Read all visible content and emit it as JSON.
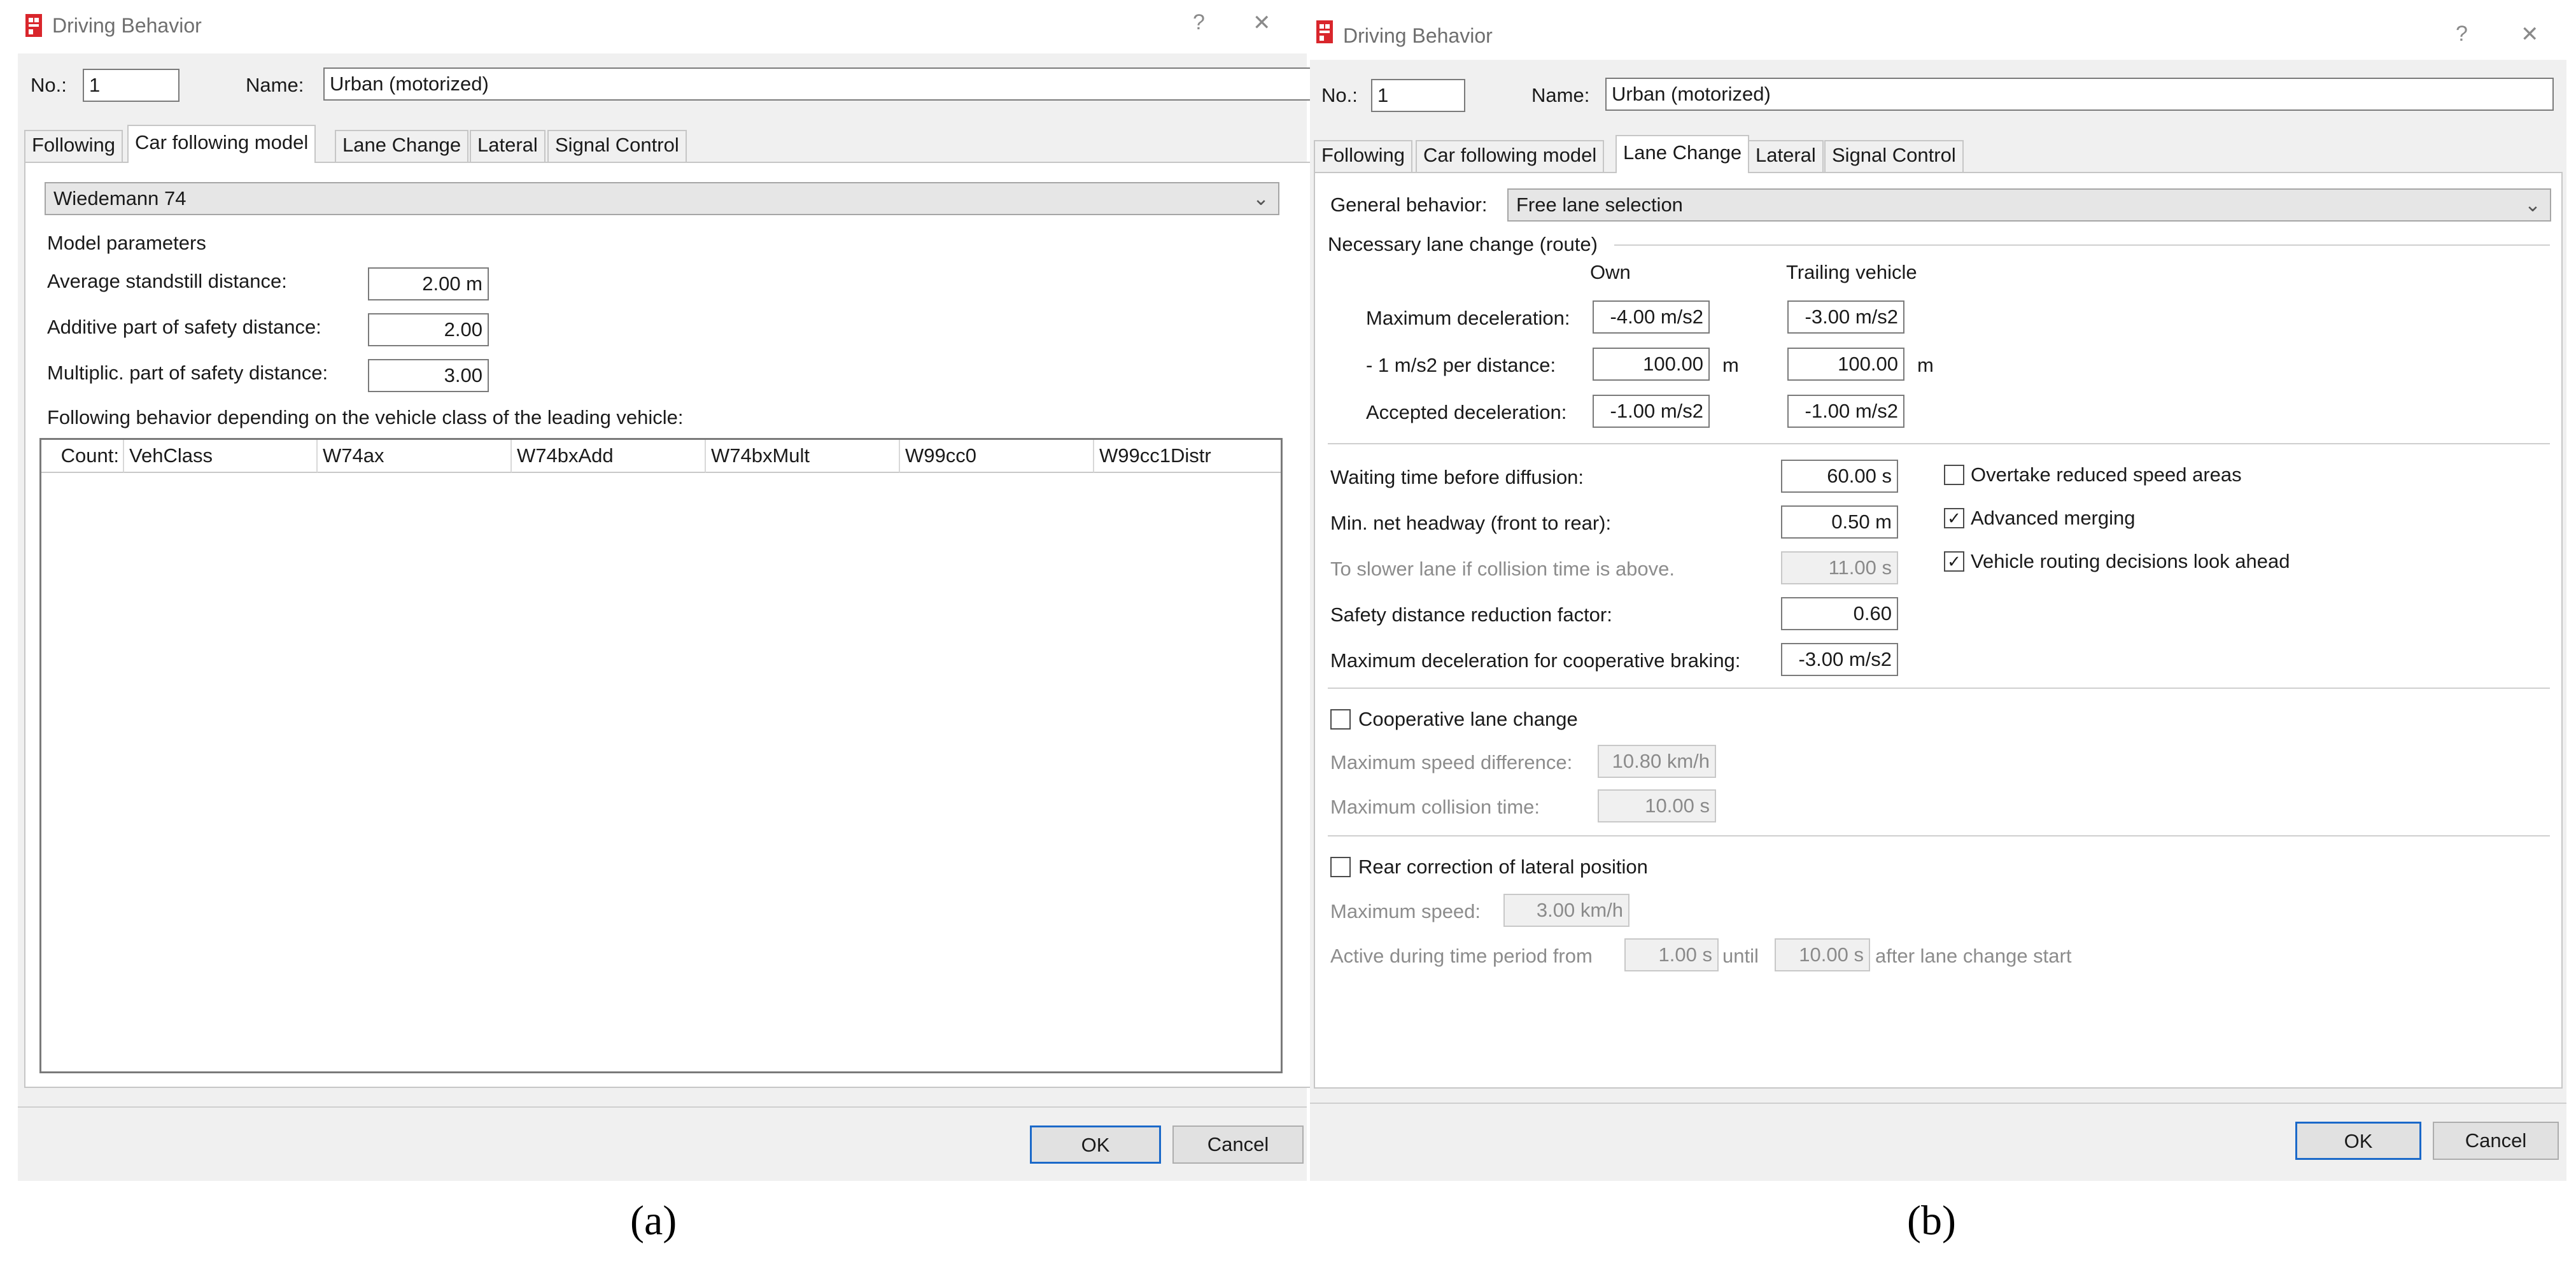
{
  "dialogA": {
    "title": "Driving Behavior",
    "help": "?",
    "close": "✕",
    "no_label": "No.:",
    "no_value": "1",
    "name_label": "Name:",
    "name_value": "Urban (motorized)",
    "tabs": [
      "Following",
      "Car following model",
      "Lane Change",
      "Lateral",
      "Signal Control"
    ],
    "model_select": "Wiedemann 74",
    "model_params_label": "Model parameters",
    "avg_standstill_label": "Average standstill distance:",
    "avg_standstill_value": "2.00 m",
    "additive_label": "Additive part of safety distance:",
    "additive_value": "2.00",
    "multiplic_label": "Multiplic. part of safety distance:",
    "multiplic_value": "3.00",
    "following_by_class_label": "Following behavior depending on the vehicle class of the leading vehicle:",
    "table_columns": [
      "Count:",
      "VehClass",
      "W74ax",
      "W74bxAdd",
      "W74bxMult",
      "W99cc0",
      "W99cc1Distr"
    ],
    "ok": "OK",
    "cancel": "Cancel",
    "caption": "(a)"
  },
  "dialogB": {
    "title": "Driving Behavior",
    "help": "?",
    "close": "✕",
    "no_label": "No.:",
    "no_value": "1",
    "name_label": "Name:",
    "name_value": "Urban (motorized)",
    "tabs": [
      "Following",
      "Car following model",
      "Lane Change",
      "Lateral",
      "Signal Control"
    ],
    "general_behavior_label": "General behavior:",
    "general_behavior_value": "Free lane selection",
    "necessary_label": "Necessary lane change (route)",
    "own_header": "Own",
    "trailing_header": "Trailing vehicle",
    "max_decel_label": "Maximum deceleration:",
    "max_decel_own": "-4.00 m/s2",
    "max_decel_trailing": "-3.00 m/s2",
    "per_distance_label": "- 1 m/s2 per distance:",
    "per_distance_own": "100.00",
    "per_distance_trailing": "100.00",
    "unit_m": "m",
    "accepted_decel_label": "Accepted deceleration:",
    "accepted_decel_own": "-1.00 m/s2",
    "accepted_decel_trailing": "-1.00 m/s2",
    "waiting_label": "Waiting time before diffusion:",
    "waiting_value": "60.00 s",
    "min_headway_label": "Min. net headway (front to rear):",
    "min_headway_value": "0.50 m",
    "slower_lane_label": "To slower lane if collision time is above.",
    "slower_lane_value": "11.00 s",
    "safety_reduction_label": "Safety distance reduction factor:",
    "safety_reduction_value": "0.60",
    "coop_braking_label": "Maximum deceleration for cooperative braking:",
    "coop_braking_value": "-3.00 m/s2",
    "overtake_label": "Overtake reduced speed areas",
    "advanced_merging_label": "Advanced merging",
    "routing_lookahead_label": "Vehicle routing decisions look ahead",
    "check_mark": "✓",
    "coop_lane_change_label": "Cooperative lane change",
    "max_speed_diff_label": "Maximum speed difference:",
    "max_speed_diff_value": "10.80 km/h",
    "max_collision_label": "Maximum collision time:",
    "max_collision_value": "10.00 s",
    "rear_correction_label": "Rear correction of lateral position",
    "max_speed_label": "Maximum speed:",
    "max_speed_value": "3.00 km/h",
    "active_from_label": "Active during time period from",
    "active_from_value": "1.00 s",
    "until_label": "until",
    "until_value": "10.00 s",
    "after_label": "after lane change start",
    "ok": "OK",
    "cancel": "Cancel",
    "caption": "(b)"
  },
  "icons": {
    "app": "app-logo-icon",
    "dropdown": "chevron-down-icon"
  },
  "colors": {
    "logo": "#d9262c",
    "default_button_border": "#1b69c9"
  }
}
